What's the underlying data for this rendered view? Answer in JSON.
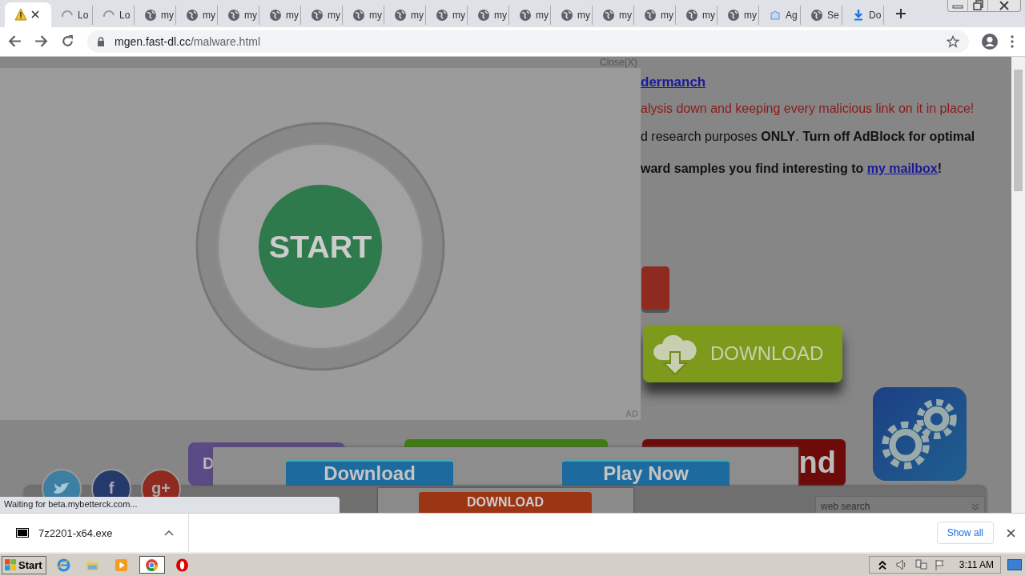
{
  "tabs": [
    {
      "kind": "warning",
      "selected": true
    },
    {
      "kind": "spinner",
      "label": "Lo",
      "selected": false
    },
    {
      "kind": "spinner",
      "label": "Lo",
      "selected": false
    },
    {
      "kind": "globe",
      "label": "my",
      "selected": false
    },
    {
      "kind": "globe",
      "label": "my",
      "selected": false
    },
    {
      "kind": "globe",
      "label": "my",
      "selected": false
    },
    {
      "kind": "globe",
      "label": "my",
      "selected": false
    },
    {
      "kind": "globe",
      "label": "my",
      "selected": false
    },
    {
      "kind": "globe",
      "label": "my",
      "selected": false
    },
    {
      "kind": "globe",
      "label": "my",
      "selected": false
    },
    {
      "kind": "globe",
      "label": "my",
      "selected": false
    },
    {
      "kind": "globe",
      "label": "my",
      "selected": false
    },
    {
      "kind": "globe",
      "label": "my",
      "selected": false
    },
    {
      "kind": "globe",
      "label": "my",
      "selected": false
    },
    {
      "kind": "globe",
      "label": "my",
      "selected": false
    },
    {
      "kind": "globe",
      "label": "my",
      "selected": false
    },
    {
      "kind": "globe",
      "label": "my",
      "selected": false
    },
    {
      "kind": "globe",
      "label": "my",
      "selected": false
    },
    {
      "kind": "puzzle",
      "label": "Ag",
      "selected": false
    },
    {
      "kind": "globe",
      "label": "Se",
      "selected": false
    },
    {
      "kind": "download",
      "label": "Do",
      "selected": false
    }
  ],
  "address": {
    "host": "mgen.fast-dl.cc",
    "path": "/malware.html"
  },
  "page": {
    "close_link": "Close(X)",
    "author_link": "dermanch",
    "warning": "alysis down and keeping every malicious link on it in place!",
    "notice": "d research purposes **ONLY**. **Turn off AdBlock for optimal**",
    "forward": {
      "text": "ward samples you find interesting to ",
      "link": "my mailbox",
      "end": "!"
    },
    "ad": {
      "button": "START",
      "label": "AD"
    },
    "download_button": "DOWNLOAD",
    "purple_button": "D",
    "red_banner": "nd",
    "popup": {
      "buttons": [
        "Download",
        "Play Now"
      ]
    },
    "popup_small": {
      "button": "DOWNLOAD"
    },
    "social": [
      {
        "kind": "bird"
      },
      {
        "kind": "text",
        "label": "f"
      },
      {
        "kind": "text",
        "label": "g+"
      }
    ],
    "search": {
      "value": "web search"
    }
  },
  "status": "Waiting for beta.mybetterck.com...",
  "download_shelf": {
    "file": "7z2201-x64.exe",
    "show_all": "Show all"
  },
  "taskbar": {
    "start": "Start",
    "apps": [
      {
        "kind": "ie",
        "selected": false
      },
      {
        "kind": "folder",
        "selected": false
      },
      {
        "kind": "media",
        "selected": false
      },
      {
        "kind": "chrome",
        "selected": true
      },
      {
        "kind": "opera",
        "selected": false
      }
    ],
    "time": "3:11 AM"
  }
}
